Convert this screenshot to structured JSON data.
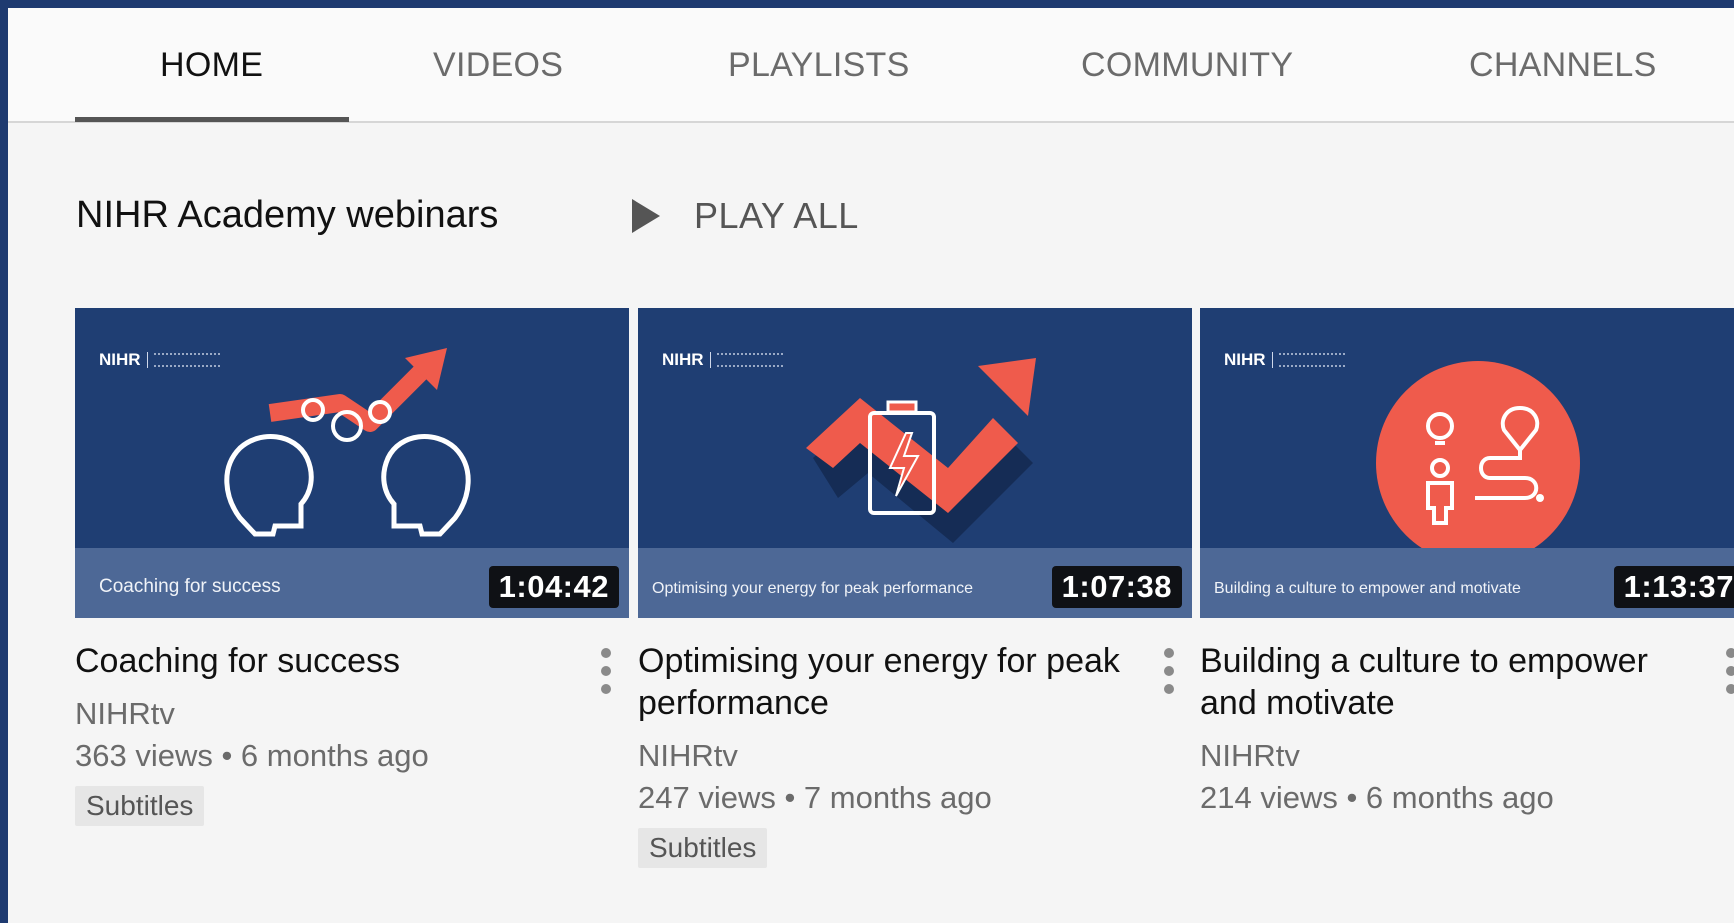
{
  "tabs": [
    {
      "label": "HOME",
      "active": true
    },
    {
      "label": "VIDEOS"
    },
    {
      "label": "PLAYLISTS"
    },
    {
      "label": "COMMUNITY"
    },
    {
      "label": "CHANNELS"
    }
  ],
  "shelf": {
    "title": "NIHR Academy webinars",
    "play_all_label": "PLAY ALL",
    "play_icon": "play-icon"
  },
  "videos": [
    {
      "thumb_logo": "NIHR",
      "thumb_caption": "Coaching for success",
      "duration": "1:04:42",
      "title": "Coaching for success",
      "channel": "NIHRtv",
      "stats": "363 views • 6 months ago",
      "badge": "Subtitles"
    },
    {
      "thumb_logo": "NIHR",
      "thumb_caption": "Optimising your energy for peak performance",
      "duration": "1:07:38",
      "title": "Optimising your energy for peak performance",
      "channel": "NIHRtv",
      "stats": "247 views • 7 months ago",
      "badge": "Subtitles"
    },
    {
      "thumb_logo": "NIHR",
      "thumb_caption": "Building a culture to empower and motivate",
      "duration": "1:13:37",
      "title": "Building a culture to empower and motivate",
      "channel": "NIHRtv",
      "stats": "214 views • 6 months ago",
      "badge": ""
    }
  ],
  "colors": {
    "frame": "#1e3a70",
    "thumb_bg": "#1f3e73",
    "banner": "#4d6896",
    "accent_red": "#ef5b4c"
  }
}
